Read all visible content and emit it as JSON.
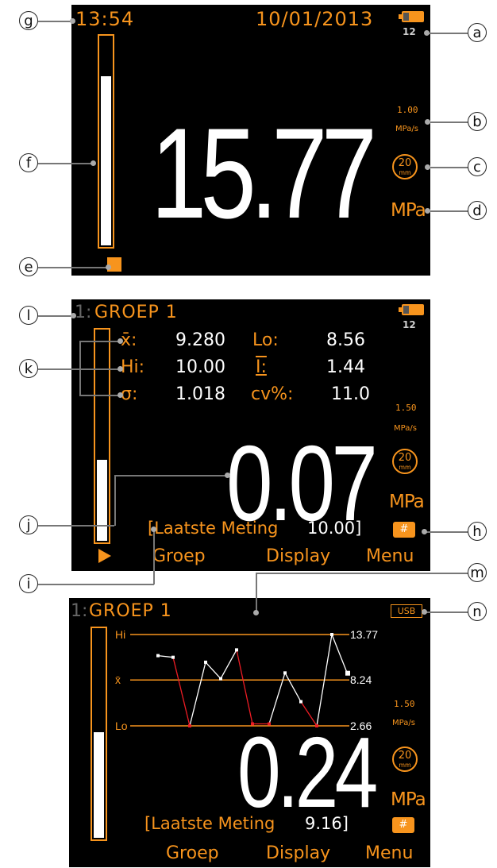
{
  "screen1": {
    "time": "13:54",
    "date": "10/01/2013",
    "battery_count": "12",
    "rate_value": "1.00",
    "rate_unit": "MPa/s",
    "circle_value": "20",
    "circle_unit": "mm",
    "reading": "15.77",
    "unit": "MPa",
    "bar_fill": 0.8
  },
  "screen2": {
    "group_index": "1:",
    "group_name": "GROEP 1",
    "battery_count": "12",
    "stats": [
      {
        "label": "x̄:",
        "value": "9.280",
        "label2": "Lo:",
        "value2": "8.56"
      },
      {
        "label": "Hi:",
        "value": "10.00",
        "label2": "I:",
        "value2": "1.44"
      },
      {
        "label": "σ:",
        "value": "1.018",
        "label2": "cv%:",
        "value2": "11.0"
      }
    ],
    "rate_value": "1.50",
    "rate_unit": "MPa/s",
    "circle_value": "20",
    "circle_unit": "mm",
    "reading": "0.07",
    "unit": "MPa",
    "last_label": "[Laatste Meting",
    "last_value": "10.00]",
    "hash": "#",
    "menu": [
      "Groep",
      "Display",
      "Menu"
    ],
    "bar_fill": 0.38
  },
  "screen3": {
    "group_index": "1:",
    "group_name": "GROEP 1",
    "usb": "USB",
    "rate_value": "1.50",
    "rate_unit": "MPa/s",
    "circle_value": "20",
    "circle_unit": "mm",
    "reading": "0.24",
    "unit": "MPa",
    "last_label": "[Laatste Meting",
    "last_value": "9.16]",
    "hash": "#",
    "menu": [
      "Groep",
      "Display",
      "Menu"
    ],
    "bar_fill": 0.5,
    "graph": {
      "hi_label": "Hi",
      "mean_label": "x̄",
      "lo_label": "Lo",
      "hi_value": "13.77",
      "mean_value": "8.24",
      "lo_value": "2.66"
    }
  },
  "chart_data": {
    "type": "line",
    "x": [
      1,
      2,
      3,
      4,
      5,
      6,
      7,
      8,
      9,
      10,
      11,
      12,
      13
    ],
    "values": [
      11.2,
      11.0,
      2.66,
      10.4,
      8.4,
      11.9,
      2.9,
      2.9,
      9.1,
      5.6,
      2.66,
      13.77,
      9.16
    ],
    "hi": 13.77,
    "mean": 8.24,
    "lo": 2.66,
    "below_mean_color": "#ed1c24",
    "above_mean_color": "#ffffff",
    "ref_line_color": "#f7941d"
  },
  "callouts": [
    "a",
    "b",
    "c",
    "d",
    "e",
    "f",
    "g",
    "h",
    "i",
    "j",
    "k",
    "l",
    "m",
    "n"
  ],
  "colors": {
    "accent": "#f7941d",
    "background": "#000000",
    "text": "#ffffff"
  }
}
